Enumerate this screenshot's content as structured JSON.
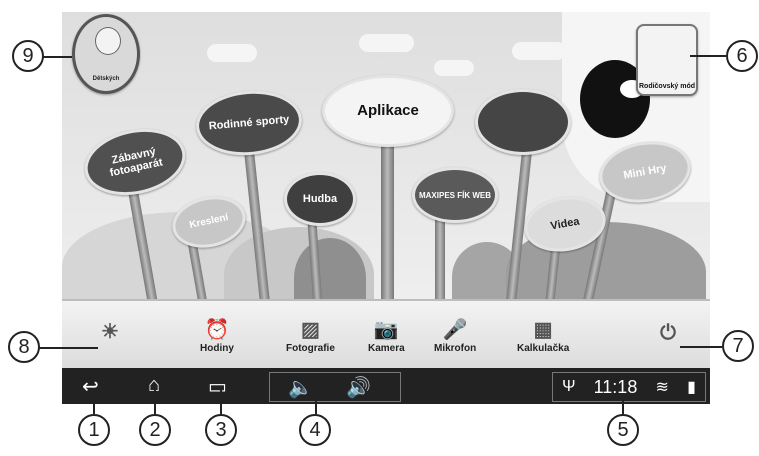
{
  "labels": {
    "detske": "Dětských",
    "rodic": "Rodičovský mód",
    "zabavny": "Zábavný fotoaparát",
    "rodinne": "Rodinné sporty",
    "aplikace": "Aplikace",
    "kresleni": "Kreslení",
    "hudba": "Hudba",
    "maxipes": "MAXIPES FÍK WEB",
    "videa": "Videa",
    "mini": "Mini Hry"
  },
  "dock": {
    "hodiny": "Hodiny",
    "fotografie": "Fotografie",
    "kamera": "Kamera",
    "mikrofon": "Mikrofon",
    "kalkulacka": "Kalkulačka"
  },
  "status": {
    "time": "11:18"
  },
  "callouts": {
    "c1": "1",
    "c2": "2",
    "c3": "3",
    "c4": "4",
    "c5": "5",
    "c6": "6",
    "c7": "7",
    "c8": "8",
    "c9": "9"
  },
  "icons": {
    "back": "back-arrow-icon",
    "home": "home-icon",
    "recent": "recent-apps-icon",
    "vol_down": "volume-down-icon",
    "vol_up": "volume-up-icon",
    "usb": "usb-icon",
    "wifi": "wifi-icon",
    "battery": "battery-icon",
    "brightness": "sun-icon",
    "power": "power-icon"
  }
}
